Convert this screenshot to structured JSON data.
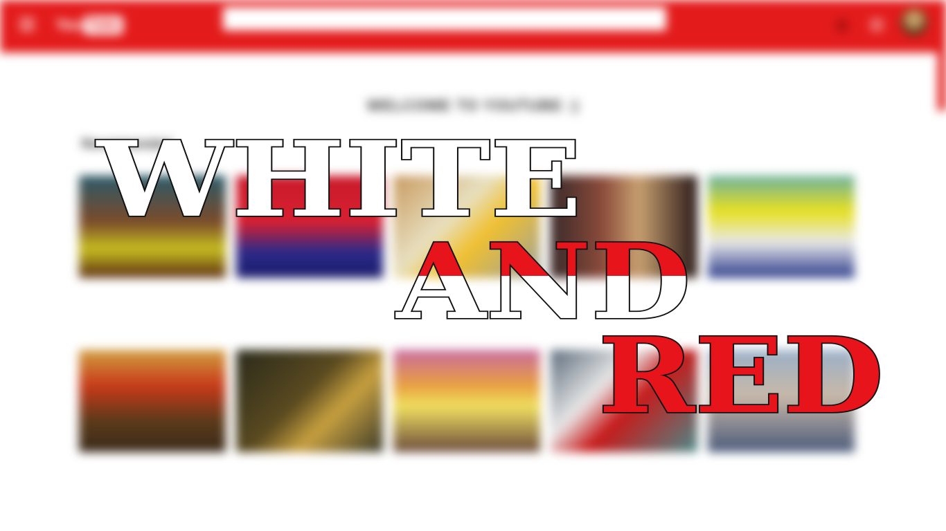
{
  "header": {
    "logo_you": "You",
    "logo_tube": "Tube",
    "search_placeholder": "",
    "brand_color": "#e31b1b",
    "icons": [
      "menu-icon",
      "upload-icon",
      "apps-icon",
      "avatar"
    ]
  },
  "main": {
    "welcome": "WELCOME TO YOUTUBE :)",
    "section_title": "Recommended",
    "videos": [
      {
        "title": "",
        "meta": ""
      },
      {
        "title": "",
        "meta": ""
      },
      {
        "title": "",
        "meta": ""
      },
      {
        "title": "",
        "meta": ""
      },
      {
        "title": "",
        "meta": ""
      },
      {
        "title": "",
        "meta": ""
      },
      {
        "title": "",
        "meta": ""
      },
      {
        "title": "",
        "meta": ""
      },
      {
        "title": "",
        "meta": ""
      },
      {
        "title": "",
        "meta": ""
      }
    ]
  },
  "overlay": {
    "word1": "WHITE",
    "word2": "AND",
    "word3": "RED",
    "white": "#ffffff",
    "red": "#e8141c",
    "outline": "#111111"
  }
}
